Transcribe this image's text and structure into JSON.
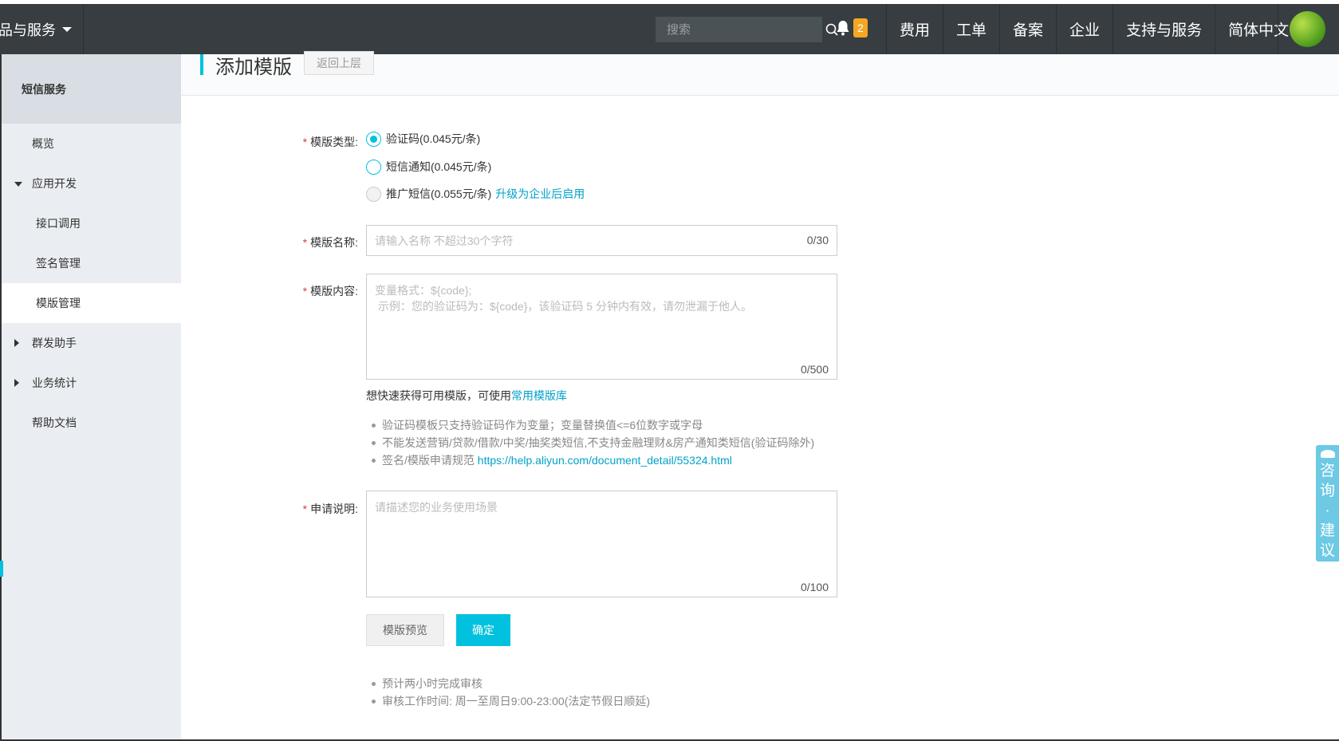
{
  "topbar": {
    "products_menu": "品与服务",
    "search_placeholder": "搜索",
    "notification_count": "2",
    "nav": [
      "费用",
      "工单",
      "备案",
      "企业",
      "支持与服务",
      "简体中文"
    ]
  },
  "sidebar": {
    "title": "短信服务",
    "items": [
      {
        "label": "概览"
      },
      {
        "label": "应用开发"
      },
      {
        "label": "接口调用"
      },
      {
        "label": "签名管理"
      },
      {
        "label": "模版管理"
      },
      {
        "label": "群发助手"
      },
      {
        "label": "业务统计"
      },
      {
        "label": "帮助文档"
      }
    ]
  },
  "page": {
    "title": "添加模版",
    "back_label": "返回上层"
  },
  "form": {
    "type_label": "模版类型:",
    "type_options": [
      {
        "label": "验证码(0.045元/条)",
        "checked": true
      },
      {
        "label": "短信通知(0.045元/条)",
        "checked": false
      },
      {
        "label": "推广短信(0.055元/条)",
        "checked": false,
        "disabled": true
      }
    ],
    "upgrade_link": "升级为企业后启用",
    "name_label": "模版名称:",
    "name_placeholder": "请输入名称 不超过30个字符",
    "name_counter": "0/30",
    "content_label": "模版内容:",
    "content_placeholder": "变量格式：${code};\n 示例：您的验证码为：${code}，该验证码 5 分钟内有效，请勿泄漏于他人。",
    "content_counter": "0/500",
    "quick_tip_text": "想快速获得可用模版，可使用",
    "quick_tip_link": "常用模版库",
    "rules": [
      "验证码模板只支持验证码作为变量；变量替换值<=6位数字或字母",
      "不能发送营销/贷款/借款/中奖/抽奖类短信,不支持金融理财&房产通知类短信(验证码除外)"
    ],
    "rule3_text": "签名/模版申请规范 ",
    "rule3_link": "https://help.aliyun.com/document_detail/55324.html",
    "desc_label": "申请说明:",
    "desc_placeholder": "请描述您的业务使用场景",
    "desc_counter": "0/100",
    "preview_button": "模版预览",
    "confirm_button": "确定",
    "notes": [
      "预计两小时完成审核",
      "审核工作时间: 周一至周日9:00-23:00(法定节假日顺延)"
    ]
  },
  "float_help": {
    "chars": [
      "咨",
      "询",
      "·",
      "建",
      "议"
    ]
  }
}
